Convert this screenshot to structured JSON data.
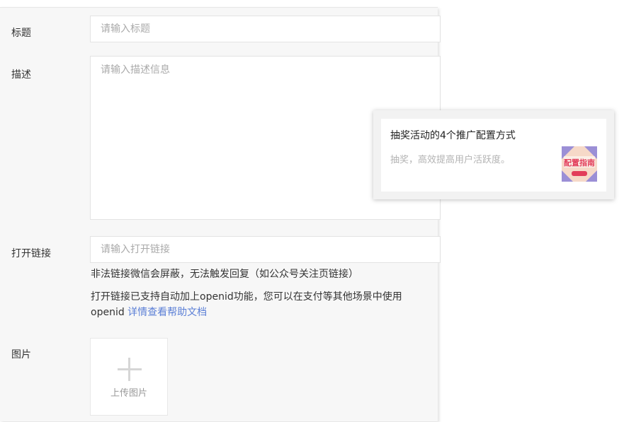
{
  "form": {
    "title_label": "标题",
    "title_placeholder": "请输入标题",
    "desc_label": "描述",
    "desc_placeholder": "请输入描述信息",
    "link_label": "打开链接",
    "link_placeholder": "请输入打开链接",
    "link_hint1": "非法链接微信会屏蔽，无法触发回复（如公众号关注页链接）",
    "link_hint2": "打开链接已支持自动加上openid功能，您可以在支付等其他场景中使用",
    "link_hint3_prefix": "openid",
    "link_hint3_link": "详情查看帮助文档",
    "image_label": "图片",
    "upload_text": "上传图片"
  },
  "preview_card": {
    "title": "抽奖活动的4个推广配置方式",
    "desc": "抽奖，高效提高用户活跃度。",
    "thumb_icon": "guide-thumbnail-icon",
    "thumb_logo_text": "配置指南"
  }
}
